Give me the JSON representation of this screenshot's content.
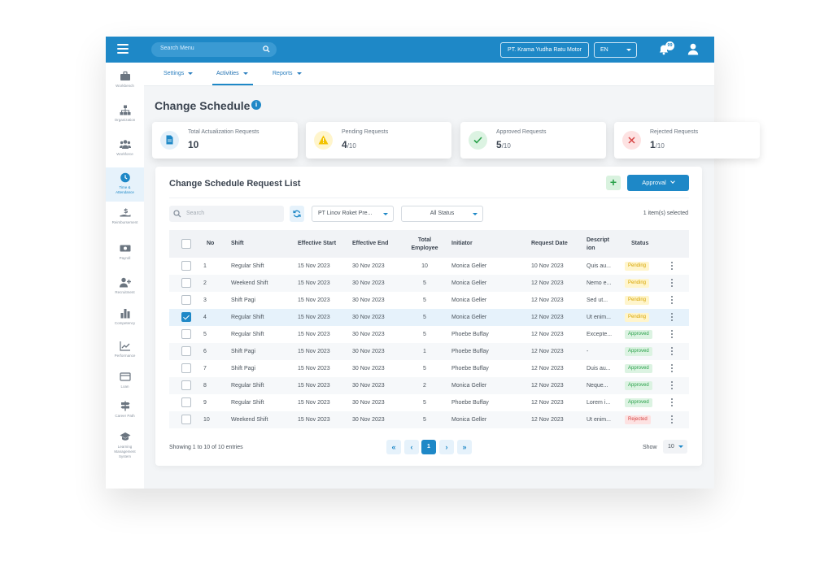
{
  "topbar": {
    "search_placeholder": "Search Menu",
    "company": "PT. Krama Yudha Ratu Motor",
    "language": "EN",
    "notification_count": "99"
  },
  "sidebar": {
    "items": [
      {
        "label": "Workbench",
        "icon": "briefcase-icon"
      },
      {
        "label": "Organization",
        "icon": "org-chart-icon"
      },
      {
        "label": "Workforce",
        "icon": "people-icon"
      },
      {
        "label": "Time & Attendance",
        "icon": "clock-icon"
      },
      {
        "label": "Reimbursement",
        "icon": "reimbursement-icon"
      },
      {
        "label": "Payroll",
        "icon": "money-icon"
      },
      {
        "label": "Recruitment",
        "icon": "add-user-icon"
      },
      {
        "label": "Competency",
        "icon": "bar-chart-icon"
      },
      {
        "label": "Performance",
        "icon": "trend-chart-icon"
      },
      {
        "label": "Loan",
        "icon": "card-icon"
      },
      {
        "label": "Career Path",
        "icon": "signpost-icon"
      },
      {
        "label": "Learning Management System",
        "icon": "graduation-cap-icon"
      }
    ]
  },
  "subnav": {
    "tabs": [
      "Settings",
      "Activities",
      "Reports"
    ]
  },
  "page": {
    "title": "Change Schedule"
  },
  "cards": [
    {
      "title": "Total Actualization Requests",
      "value": "10",
      "suffix": ""
    },
    {
      "title": "Pending Requests",
      "value": "4",
      "suffix": "/10"
    },
    {
      "title": "Approved Requests",
      "value": "5",
      "suffix": "/10"
    },
    {
      "title": "Rejected Requests",
      "value": "1",
      "suffix": "/10"
    }
  ],
  "panel": {
    "title": "Change Schedule Request List",
    "add_label": "+",
    "approval_label": "Approval"
  },
  "filters": {
    "search_placeholder": "Search",
    "company_filter": "PT Linov Roket Pre...",
    "status_filter": "All Status",
    "selected_count": "1 item(s) selected"
  },
  "table": {
    "headers": {
      "no": "No",
      "shift": "Shift",
      "effective_start": "Effective Start",
      "effective_end": "Effective End",
      "total_employee_1": "Total",
      "total_employee_2": "Employee",
      "initiator": "Initiator",
      "request_date": "Request Date",
      "description_1": "Descript",
      "description_2": "ion",
      "status": "Status"
    },
    "rows": [
      {
        "no": "1",
        "shift": "Regular Shift",
        "start": "15 Nov 2023",
        "end": "30 Nov 2023",
        "total": "10",
        "initiator": "Monica Geller",
        "date": "10 Nov 2023",
        "desc": "Quis au...",
        "status": "Pending",
        "checked": false
      },
      {
        "no": "2",
        "shift": "Weekend Shift",
        "start": "15 Nov 2023",
        "end": "30 Nov 2023",
        "total": "5",
        "initiator": "Monica Geller",
        "date": "12 Nov 2023",
        "desc": "Nemo e...",
        "status": "Pending",
        "checked": false
      },
      {
        "no": "3",
        "shift": "Shift Pagi",
        "start": "15 Nov 2023",
        "end": "30 Nov 2023",
        "total": "5",
        "initiator": "Monica Geller",
        "date": "12 Nov 2023",
        "desc": "Sed ut...",
        "status": "Pending",
        "checked": false
      },
      {
        "no": "4",
        "shift": "Regular Shift",
        "start": "15 Nov 2023",
        "end": "30 Nov 2023",
        "total": "5",
        "initiator": "Monica Geller",
        "date": "12 Nov 2023",
        "desc": "Ut enim...",
        "status": "Pending",
        "checked": true
      },
      {
        "no": "5",
        "shift": "Regular Shift",
        "start": "15 Nov 2023",
        "end": "30 Nov 2023",
        "total": "5",
        "initiator": "Phoebe Buffay",
        "date": "12 Nov 2023",
        "desc": "Excepte...",
        "status": "Approved",
        "checked": false
      },
      {
        "no": "6",
        "shift": "Shift Pagi",
        "start": "15 Nov 2023",
        "end": "30 Nov 2023",
        "total": "1",
        "initiator": "Phoebe Buffay",
        "date": "12 Nov 2023",
        "desc": "-",
        "status": "Approved",
        "checked": false
      },
      {
        "no": "7",
        "shift": "Shift Pagi",
        "start": "15 Nov 2023",
        "end": "30 Nov 2023",
        "total": "5",
        "initiator": "Phoebe Buffay",
        "date": "12 Nov 2023",
        "desc": "Duis au...",
        "status": "Approved",
        "checked": false
      },
      {
        "no": "8",
        "shift": "Regular Shift",
        "start": "15 Nov 2023",
        "end": "30 Nov 2023",
        "total": "2",
        "initiator": "Monica Geller",
        "date": "12 Nov 2023",
        "desc": "Neque...",
        "status": "Approved",
        "checked": false
      },
      {
        "no": "9",
        "shift": "Regular Shift",
        "start": "15 Nov 2023",
        "end": "30 Nov 2023",
        "total": "5",
        "initiator": "Phoebe Buffay",
        "date": "12 Nov 2023",
        "desc": "Lorem i...",
        "status": "Approved",
        "checked": false
      },
      {
        "no": "10",
        "shift": "Weekend Shift",
        "start": "15 Nov 2023",
        "end": "30 Nov 2023",
        "total": "5",
        "initiator": "Monica Geller",
        "date": "12 Nov 2023",
        "desc": "Ut enim...",
        "status": "Rejected",
        "checked": false
      }
    ]
  },
  "pagination": {
    "summary": "Showing 1 to 10 of 10 entries",
    "first": "«",
    "prev": "‹",
    "current": "1",
    "next": "›",
    "last": "»",
    "show_label": "Show",
    "page_size": "10"
  },
  "colors": {
    "primary": "#1e88c7",
    "pending": "#d6a400",
    "approved": "#2aa14a",
    "rejected": "#d64545"
  }
}
